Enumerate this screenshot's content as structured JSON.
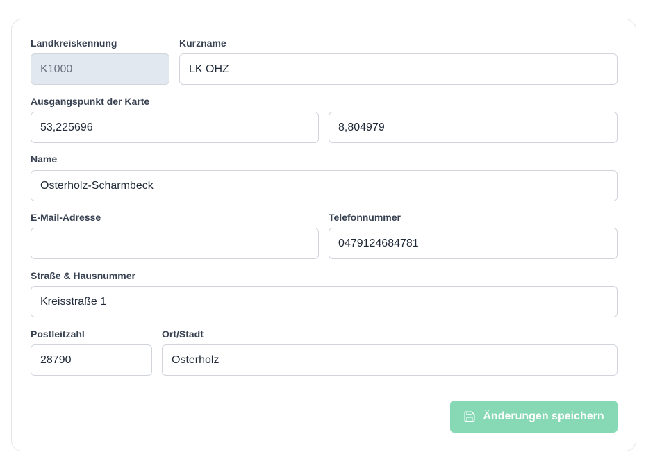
{
  "form": {
    "district_id": {
      "label": "Landkreiskennung",
      "value": "K1000"
    },
    "short_name": {
      "label": "Kurzname",
      "value": "LK OHZ"
    },
    "map_origin": {
      "label": "Ausgangspunkt der Karte",
      "latitude": "53,225696",
      "longitude": "8,804979"
    },
    "name": {
      "label": "Name",
      "value": "Osterholz-Scharmbeck"
    },
    "email": {
      "label": "E-Mail-Adresse",
      "value": ""
    },
    "phone": {
      "label": "Telefonnummer",
      "value": "0479124684781"
    },
    "street": {
      "label": "Straße & Hausnummer",
      "value": "Kreisstraße 1"
    },
    "postal_code": {
      "label": "Postleitzahl",
      "value": "28790"
    },
    "city": {
      "label": "Ort/Stadt",
      "value": "Osterholz"
    }
  },
  "actions": {
    "save_label": "Änderungen speichern",
    "save_icon": "save-icon",
    "save_color": "#86d9b4"
  }
}
